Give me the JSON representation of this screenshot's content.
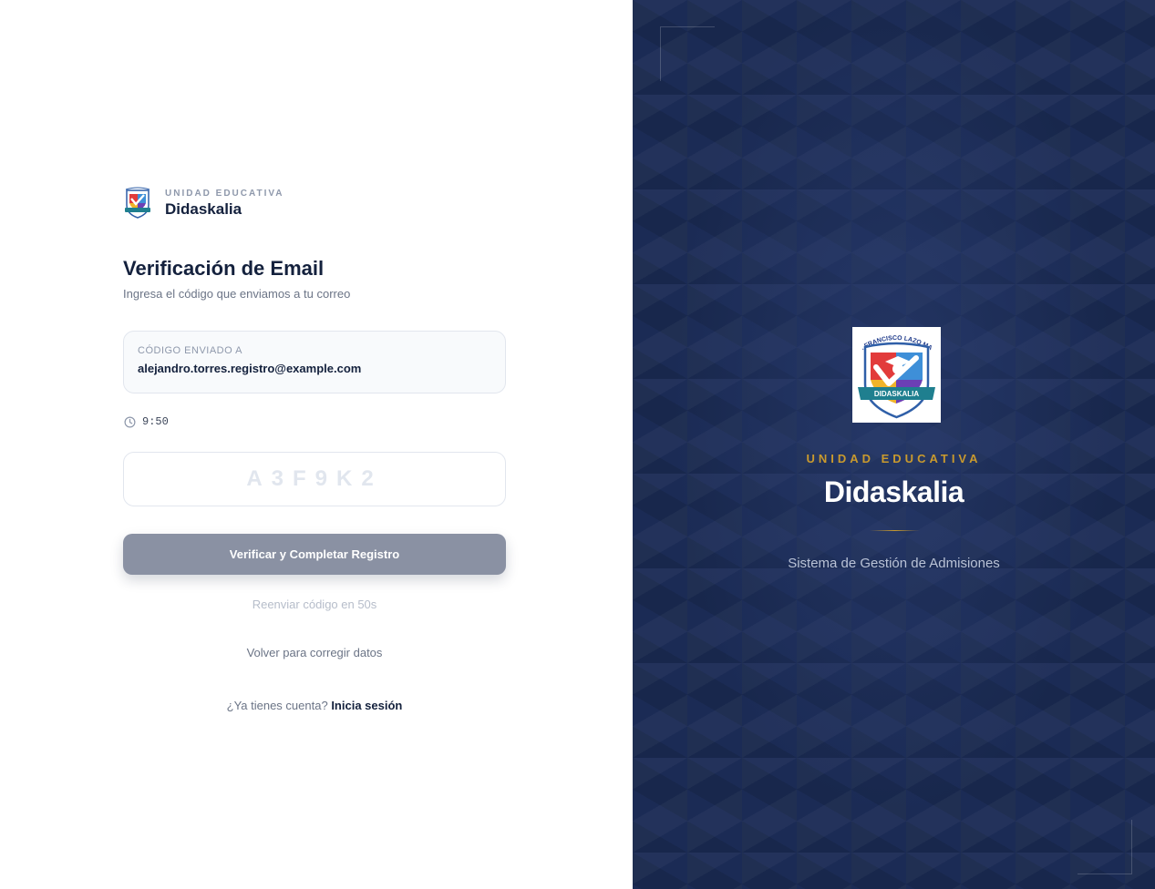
{
  "brand": {
    "kicker": "UNIDAD EDUCATIVA",
    "name": "Didaskalia"
  },
  "form": {
    "title": "Verificación de Email",
    "subtitle": "Ingresa el código que enviamos a tu correo",
    "sent_label": "CÓDIGO ENVIADO A",
    "sent_email": "alejandro.torres.registro@example.com",
    "timer": "9:50",
    "code_placeholder": "A3F9K2",
    "code_value": "",
    "verify_label": "Verificar y Completar Registro",
    "resend_text": "Reenviar código en 50s",
    "back_label": "Volver para corregir datos",
    "login_prompt": "¿Ya tienes cuenta?",
    "login_link": "Inicia sesión"
  },
  "hero": {
    "logo_text": "U.E. FRANCISCO LAZO MARTÍ",
    "logo_banner": "DIDASKALIA",
    "kicker": "UNIDAD EDUCATIVA",
    "name": "Didaskalia",
    "tagline": "Sistema de Gestión de Admisiones"
  },
  "colors": {
    "navy": "#14213d",
    "panel": "#1b2b55",
    "gold": "#c99a2e",
    "button_disabled": "#8a91a3"
  },
  "icons": {
    "timer": "clock-icon",
    "logo": "school-shield-logo"
  }
}
